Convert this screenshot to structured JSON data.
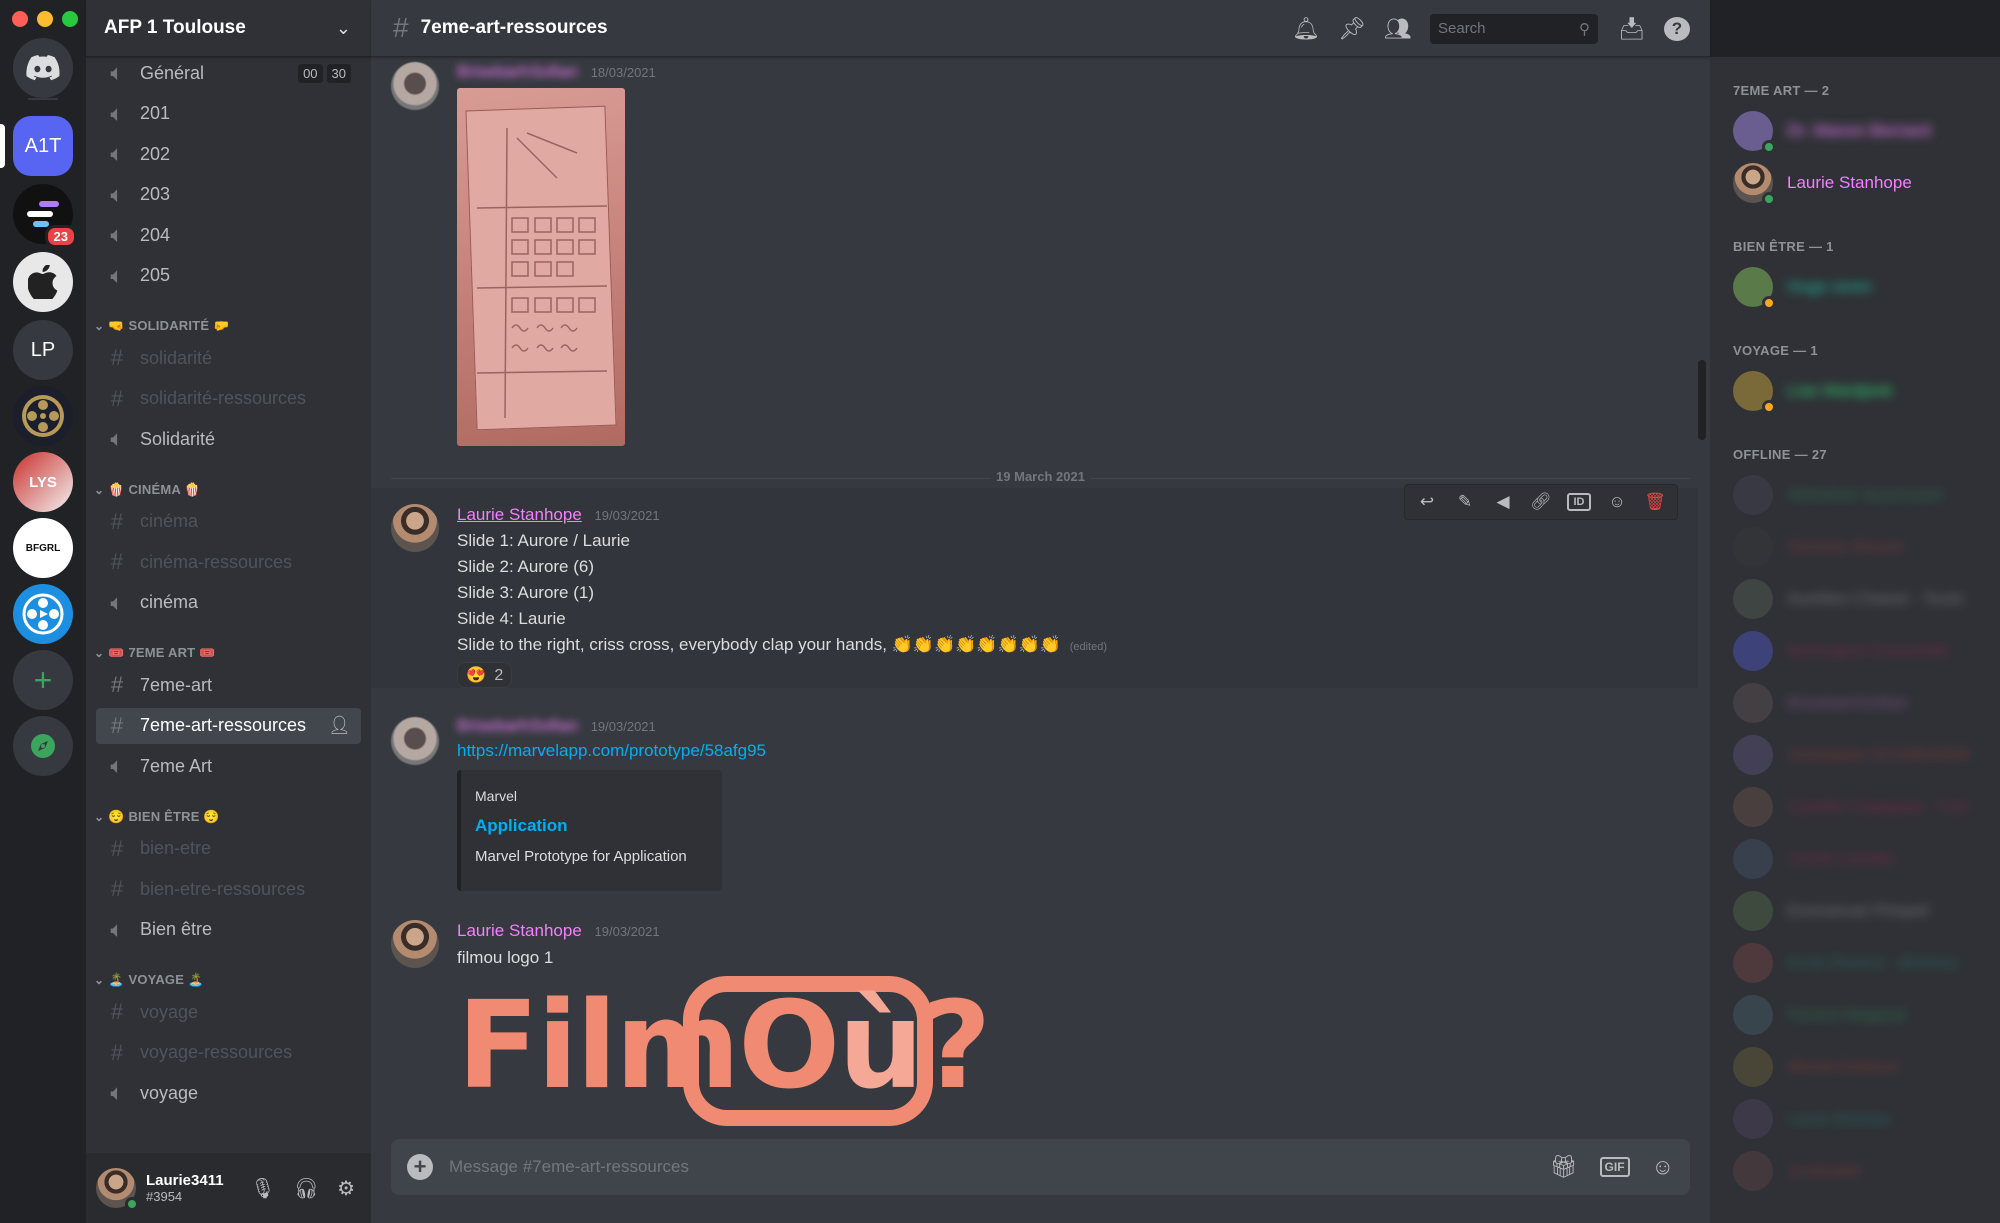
{
  "window": {
    "controls": [
      "close",
      "minimize",
      "maximize"
    ]
  },
  "servers": [
    {
      "label": "",
      "icon": "discord-home-icon"
    },
    {
      "label": "A1T"
    },
    {
      "label": "",
      "badge": "23"
    },
    {
      "label": "",
      "icon": "apple-icon"
    },
    {
      "label": "LP"
    },
    {
      "label": "",
      "icon": "film-reel-icon"
    },
    {
      "label": "LYS"
    },
    {
      "label": "BFGRL"
    },
    {
      "label": "",
      "icon": "film-icon"
    },
    {
      "label": "+",
      "icon": "add-server-icon"
    },
    {
      "label": "",
      "icon": "explore-icon"
    }
  ],
  "guild": {
    "name": "AFP 1 Toulouse"
  },
  "channels": {
    "top": [
      {
        "name": "Général",
        "type": "voice",
        "timer": [
          "00",
          "30"
        ]
      },
      {
        "name": "201",
        "type": "voice"
      },
      {
        "name": "202",
        "type": "voice"
      },
      {
        "name": "203",
        "type": "voice"
      },
      {
        "name": "204",
        "type": "voice"
      },
      {
        "name": "205",
        "type": "voice"
      }
    ],
    "categories": [
      {
        "name": "🤜 SOLIDARITÉ 🤛",
        "items": [
          {
            "name": "solidarité",
            "type": "text",
            "muted": true
          },
          {
            "name": "solidarité-ressources",
            "type": "text",
            "muted": true
          },
          {
            "name": "Solidarité",
            "type": "voice"
          }
        ]
      },
      {
        "name": "🍿 CINÉMA 🍿",
        "items": [
          {
            "name": "cinéma",
            "type": "text",
            "muted": true
          },
          {
            "name": "cinéma-ressources",
            "type": "text",
            "muted": true
          },
          {
            "name": "cinéma",
            "type": "voice"
          }
        ]
      },
      {
        "name": "🎟️ 7EME ART 🎟️",
        "items": [
          {
            "name": "7eme-art",
            "type": "text"
          },
          {
            "name": "7eme-art-ressources",
            "type": "text",
            "active": true
          },
          {
            "name": "7eme Art",
            "type": "voice"
          }
        ]
      },
      {
        "name": "😌 BIEN ÊTRE 😌",
        "items": [
          {
            "name": "bien-etre",
            "type": "text",
            "muted": true
          },
          {
            "name": "bien-etre-ressources",
            "type": "text",
            "muted": true
          },
          {
            "name": "Bien être",
            "type": "voice"
          }
        ]
      },
      {
        "name": "🏝️ VOYAGE 🏝️",
        "items": [
          {
            "name": "voyage",
            "type": "text",
            "muted": true
          },
          {
            "name": "voyage-ressources",
            "type": "text",
            "muted": true
          },
          {
            "name": "voyage",
            "type": "voice"
          }
        ]
      }
    ]
  },
  "user": {
    "name": "Laurie3411",
    "tag": "#3954"
  },
  "header": {
    "channel": "7eme-art-ressources",
    "search_placeholder": "Search"
  },
  "messages": {
    "m1": {
      "author": "BrisebarhSofian",
      "time": "18/03/2021"
    },
    "divider": "19 March 2021",
    "m2": {
      "author": "Laurie Stanhope",
      "time": "19/03/2021",
      "lines": [
        "Slide 1: Aurore / Laurie",
        "Slide 2: Aurore (6)",
        "Slide 3: Aurore (1)",
        "Slide 4: Laurie",
        "Slide to the right, criss cross, everybody clap your hands, 👏👏👏👏👏👏👏👏"
      ],
      "edited": "(edited)",
      "reaction": {
        "emoji": "😍",
        "count": "2"
      }
    },
    "m3": {
      "author": "BrisebarhSofian",
      "time": "19/03/2021",
      "link": "https://marvelapp.com/prototype/58afg95",
      "embed": {
        "provider": "Marvel",
        "title": "Application",
        "description": "Marvel Prototype for Application"
      }
    },
    "m4": {
      "author": "Laurie Stanhope",
      "time": "19/03/2021",
      "text": "filmou logo 1",
      "logo": {
        "left": "FilmO",
        "accent": "ù",
        "right": "?"
      }
    }
  },
  "composer": {
    "placeholder": "Message #7eme-art-ressources"
  },
  "member_list": {
    "groups": [
      {
        "title": "7EME ART — 2",
        "members": [
          {
            "name": "Dr. Manon Bernard",
            "status": "online",
            "blurred": true,
            "color": "#f47fff"
          },
          {
            "name": "Laurie Stanhope",
            "status": "online",
            "blurred": false,
            "color": "#f47fff"
          }
        ]
      },
      {
        "title": "BIEN ÊTRE — 1",
        "members": [
          {
            "name": "Hugo siven",
            "status": "idle",
            "blurred": true,
            "color": "#1abc9c"
          }
        ]
      },
      {
        "title": "VOYAGE — 1",
        "members": [
          {
            "name": "Lise Mardjeek",
            "status": "idle",
            "blurred": true,
            "color": "#2ecc71"
          }
        ]
      },
      {
        "title": "OFFLINE — 27",
        "members": [
          {
            "name": "Abhishek Soummani",
            "color": "#2ecc71"
          },
          {
            "name": "Dominic Bouret",
            "color": "#e74c3c"
          },
          {
            "name": "Aurélien Chanel - Toulo",
            "color": "#dcddde"
          },
          {
            "name": "Berengere Dumonide",
            "color": "#e91e63"
          },
          {
            "name": "BrisebarhSofian",
            "color": "#f47fff"
          },
          {
            "name": "christophe SCHNEIDER",
            "color": "#e74c3c"
          },
          {
            "name": "Camille Campana - Tutri",
            "color": "#e91e63"
          },
          {
            "name": "Cécile Lanella",
            "color": "#e91e63"
          },
          {
            "name": "Emmanuel Pimpeil",
            "color": "#dcddde"
          },
          {
            "name": "Ernő Zhuenz - Bizimez",
            "color": "#1abc9c"
          },
          {
            "name": "Florent Magaud",
            "color": "#2ecc71"
          },
          {
            "name": "Michel Dubeck",
            "color": "#e74c3c"
          },
          {
            "name": "Laure Bureau",
            "color": "#1abc9c"
          },
          {
            "name": "Ju bouder",
            "color": "#e74c3c"
          }
        ]
      }
    ]
  },
  "colors": {
    "accent": "#5865f2",
    "author_pink": "#f47fff",
    "link": "#00aff4",
    "logo": "#f08a72"
  }
}
